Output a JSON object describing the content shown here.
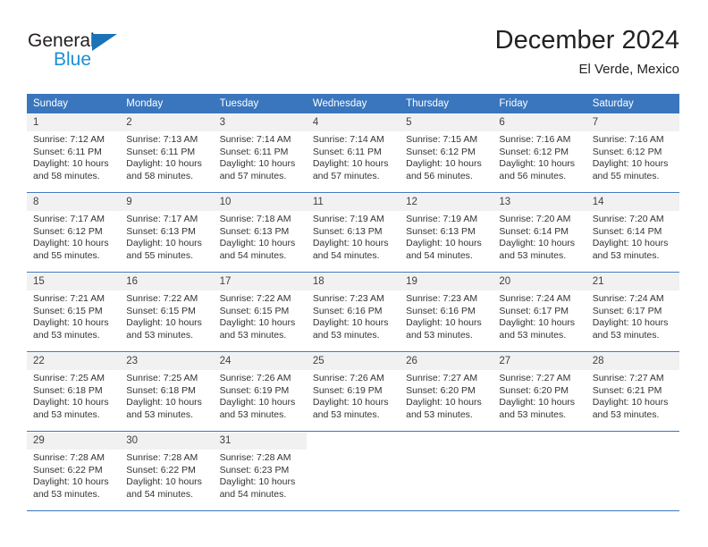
{
  "brand": {
    "name_top": "General",
    "name_bottom": "Blue"
  },
  "header": {
    "title": "December 2024",
    "location": "El Verde, Mexico"
  },
  "colors": {
    "header_blue": "#3a76bd",
    "logo_blue": "#1a8fd4",
    "day_band": "#f1f1f1"
  },
  "weekdays": [
    {
      "label": "Sunday"
    },
    {
      "label": "Monday"
    },
    {
      "label": "Tuesday"
    },
    {
      "label": "Wednesday"
    },
    {
      "label": "Thursday"
    },
    {
      "label": "Friday"
    },
    {
      "label": "Saturday"
    }
  ],
  "weeks": [
    [
      {
        "day": "1",
        "sunrise": "Sunrise: 7:12 AM",
        "sunset": "Sunset: 6:11 PM",
        "daylight_line1": "Daylight: 10 hours",
        "daylight_line2": "and 58 minutes."
      },
      {
        "day": "2",
        "sunrise": "Sunrise: 7:13 AM",
        "sunset": "Sunset: 6:11 PM",
        "daylight_line1": "Daylight: 10 hours",
        "daylight_line2": "and 58 minutes."
      },
      {
        "day": "3",
        "sunrise": "Sunrise: 7:14 AM",
        "sunset": "Sunset: 6:11 PM",
        "daylight_line1": "Daylight: 10 hours",
        "daylight_line2": "and 57 minutes."
      },
      {
        "day": "4",
        "sunrise": "Sunrise: 7:14 AM",
        "sunset": "Sunset: 6:11 PM",
        "daylight_line1": "Daylight: 10 hours",
        "daylight_line2": "and 57 minutes."
      },
      {
        "day": "5",
        "sunrise": "Sunrise: 7:15 AM",
        "sunset": "Sunset: 6:12 PM",
        "daylight_line1": "Daylight: 10 hours",
        "daylight_line2": "and 56 minutes."
      },
      {
        "day": "6",
        "sunrise": "Sunrise: 7:16 AM",
        "sunset": "Sunset: 6:12 PM",
        "daylight_line1": "Daylight: 10 hours",
        "daylight_line2": "and 56 minutes."
      },
      {
        "day": "7",
        "sunrise": "Sunrise: 7:16 AM",
        "sunset": "Sunset: 6:12 PM",
        "daylight_line1": "Daylight: 10 hours",
        "daylight_line2": "and 55 minutes."
      }
    ],
    [
      {
        "day": "8",
        "sunrise": "Sunrise: 7:17 AM",
        "sunset": "Sunset: 6:12 PM",
        "daylight_line1": "Daylight: 10 hours",
        "daylight_line2": "and 55 minutes."
      },
      {
        "day": "9",
        "sunrise": "Sunrise: 7:17 AM",
        "sunset": "Sunset: 6:13 PM",
        "daylight_line1": "Daylight: 10 hours",
        "daylight_line2": "and 55 minutes."
      },
      {
        "day": "10",
        "sunrise": "Sunrise: 7:18 AM",
        "sunset": "Sunset: 6:13 PM",
        "daylight_line1": "Daylight: 10 hours",
        "daylight_line2": "and 54 minutes."
      },
      {
        "day": "11",
        "sunrise": "Sunrise: 7:19 AM",
        "sunset": "Sunset: 6:13 PM",
        "daylight_line1": "Daylight: 10 hours",
        "daylight_line2": "and 54 minutes."
      },
      {
        "day": "12",
        "sunrise": "Sunrise: 7:19 AM",
        "sunset": "Sunset: 6:13 PM",
        "daylight_line1": "Daylight: 10 hours",
        "daylight_line2": "and 54 minutes."
      },
      {
        "day": "13",
        "sunrise": "Sunrise: 7:20 AM",
        "sunset": "Sunset: 6:14 PM",
        "daylight_line1": "Daylight: 10 hours",
        "daylight_line2": "and 53 minutes."
      },
      {
        "day": "14",
        "sunrise": "Sunrise: 7:20 AM",
        "sunset": "Sunset: 6:14 PM",
        "daylight_line1": "Daylight: 10 hours",
        "daylight_line2": "and 53 minutes."
      }
    ],
    [
      {
        "day": "15",
        "sunrise": "Sunrise: 7:21 AM",
        "sunset": "Sunset: 6:15 PM",
        "daylight_line1": "Daylight: 10 hours",
        "daylight_line2": "and 53 minutes."
      },
      {
        "day": "16",
        "sunrise": "Sunrise: 7:22 AM",
        "sunset": "Sunset: 6:15 PM",
        "daylight_line1": "Daylight: 10 hours",
        "daylight_line2": "and 53 minutes."
      },
      {
        "day": "17",
        "sunrise": "Sunrise: 7:22 AM",
        "sunset": "Sunset: 6:15 PM",
        "daylight_line1": "Daylight: 10 hours",
        "daylight_line2": "and 53 minutes."
      },
      {
        "day": "18",
        "sunrise": "Sunrise: 7:23 AM",
        "sunset": "Sunset: 6:16 PM",
        "daylight_line1": "Daylight: 10 hours",
        "daylight_line2": "and 53 minutes."
      },
      {
        "day": "19",
        "sunrise": "Sunrise: 7:23 AM",
        "sunset": "Sunset: 6:16 PM",
        "daylight_line1": "Daylight: 10 hours",
        "daylight_line2": "and 53 minutes."
      },
      {
        "day": "20",
        "sunrise": "Sunrise: 7:24 AM",
        "sunset": "Sunset: 6:17 PM",
        "daylight_line1": "Daylight: 10 hours",
        "daylight_line2": "and 53 minutes."
      },
      {
        "day": "21",
        "sunrise": "Sunrise: 7:24 AM",
        "sunset": "Sunset: 6:17 PM",
        "daylight_line1": "Daylight: 10 hours",
        "daylight_line2": "and 53 minutes."
      }
    ],
    [
      {
        "day": "22",
        "sunrise": "Sunrise: 7:25 AM",
        "sunset": "Sunset: 6:18 PM",
        "daylight_line1": "Daylight: 10 hours",
        "daylight_line2": "and 53 minutes."
      },
      {
        "day": "23",
        "sunrise": "Sunrise: 7:25 AM",
        "sunset": "Sunset: 6:18 PM",
        "daylight_line1": "Daylight: 10 hours",
        "daylight_line2": "and 53 minutes."
      },
      {
        "day": "24",
        "sunrise": "Sunrise: 7:26 AM",
        "sunset": "Sunset: 6:19 PM",
        "daylight_line1": "Daylight: 10 hours",
        "daylight_line2": "and 53 minutes."
      },
      {
        "day": "25",
        "sunrise": "Sunrise: 7:26 AM",
        "sunset": "Sunset: 6:19 PM",
        "daylight_line1": "Daylight: 10 hours",
        "daylight_line2": "and 53 minutes."
      },
      {
        "day": "26",
        "sunrise": "Sunrise: 7:27 AM",
        "sunset": "Sunset: 6:20 PM",
        "daylight_line1": "Daylight: 10 hours",
        "daylight_line2": "and 53 minutes."
      },
      {
        "day": "27",
        "sunrise": "Sunrise: 7:27 AM",
        "sunset": "Sunset: 6:20 PM",
        "daylight_line1": "Daylight: 10 hours",
        "daylight_line2": "and 53 minutes."
      },
      {
        "day": "28",
        "sunrise": "Sunrise: 7:27 AM",
        "sunset": "Sunset: 6:21 PM",
        "daylight_line1": "Daylight: 10 hours",
        "daylight_line2": "and 53 minutes."
      }
    ],
    [
      {
        "day": "29",
        "sunrise": "Sunrise: 7:28 AM",
        "sunset": "Sunset: 6:22 PM",
        "daylight_line1": "Daylight: 10 hours",
        "daylight_line2": "and 53 minutes."
      },
      {
        "day": "30",
        "sunrise": "Sunrise: 7:28 AM",
        "sunset": "Sunset: 6:22 PM",
        "daylight_line1": "Daylight: 10 hours",
        "daylight_line2": "and 54 minutes."
      },
      {
        "day": "31",
        "sunrise": "Sunrise: 7:28 AM",
        "sunset": "Sunset: 6:23 PM",
        "daylight_line1": "Daylight: 10 hours",
        "daylight_line2": "and 54 minutes."
      },
      {
        "day": "",
        "sunrise": "",
        "sunset": "",
        "daylight_line1": "",
        "daylight_line2": ""
      },
      {
        "day": "",
        "sunrise": "",
        "sunset": "",
        "daylight_line1": "",
        "daylight_line2": ""
      },
      {
        "day": "",
        "sunrise": "",
        "sunset": "",
        "daylight_line1": "",
        "daylight_line2": ""
      },
      {
        "day": "",
        "sunrise": "",
        "sunset": "",
        "daylight_line1": "",
        "daylight_line2": ""
      }
    ]
  ]
}
